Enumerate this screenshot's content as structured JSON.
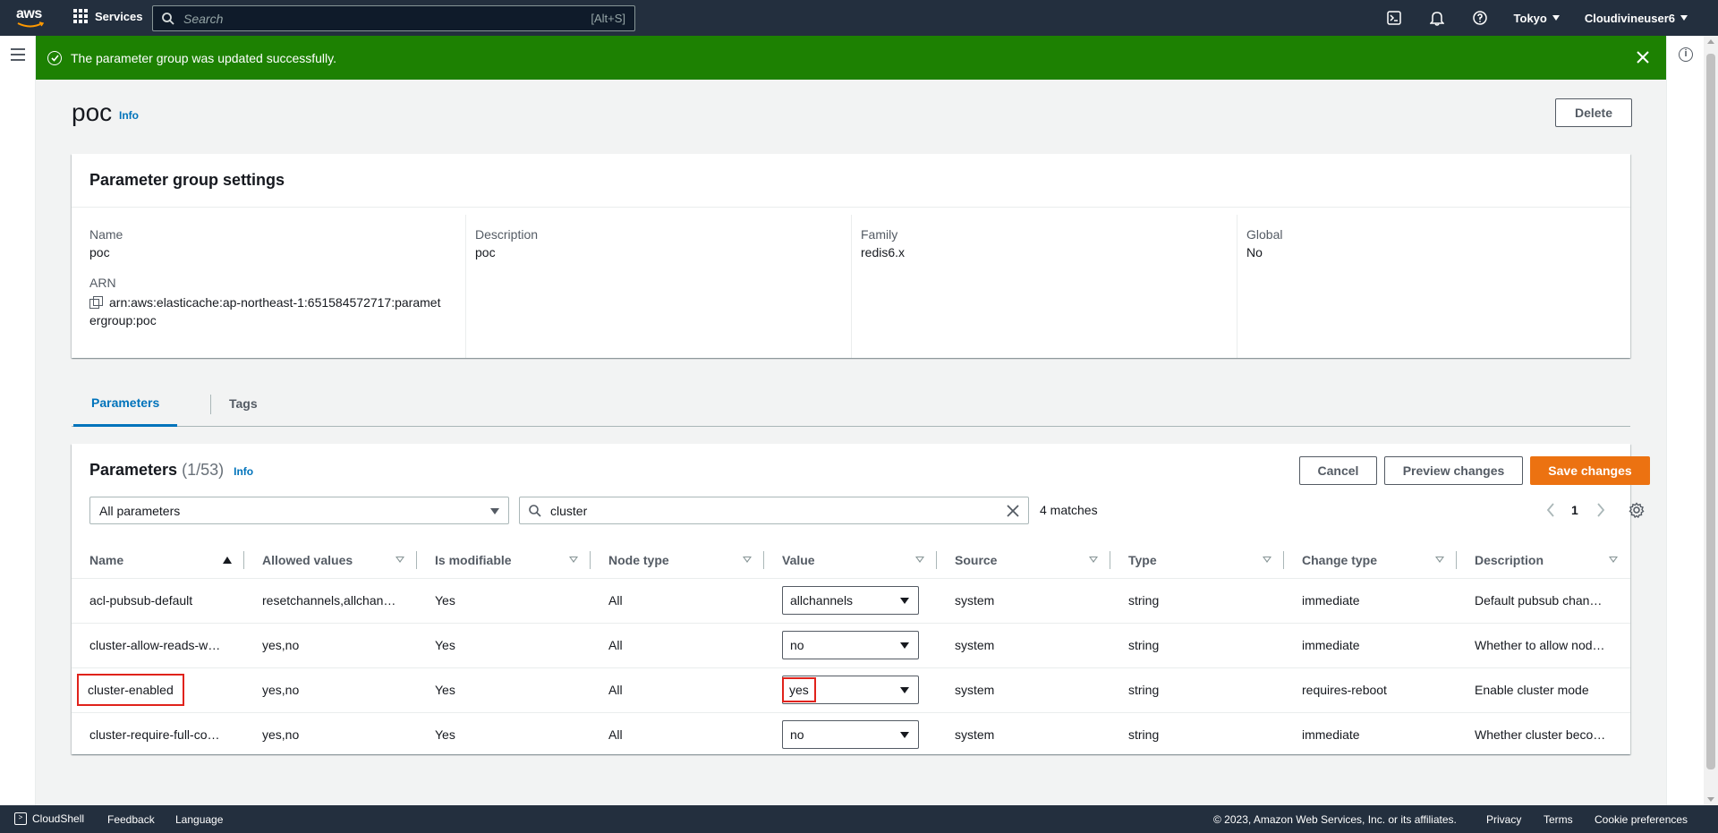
{
  "topnav": {
    "logo": "aws",
    "services_label": "Services",
    "search_placeholder": "Search",
    "search_shortcut": "[Alt+S]",
    "region": "Tokyo",
    "user": "Cloudivineuser6"
  },
  "flash": {
    "message": "The parameter group was updated successfully."
  },
  "page": {
    "title": "poc",
    "info_label": "Info",
    "delete_label": "Delete"
  },
  "settings": {
    "header": "Parameter group settings",
    "name_label": "Name",
    "name_value": "poc",
    "arn_label": "ARN",
    "arn_value_line1": "arn:aws:elasticache:ap-northeast-1:651584572717:paramet",
    "arn_value_line2": "ergroup:poc",
    "description_label": "Description",
    "description_value": "poc",
    "family_label": "Family",
    "family_value": "redis6.x",
    "global_label": "Global",
    "global_value": "No"
  },
  "tabs": [
    {
      "label": "Parameters",
      "active": true
    },
    {
      "label": "Tags",
      "active": false
    }
  ],
  "parameters": {
    "title": "Parameters",
    "count": "(1/53)",
    "info_label": "Info",
    "cancel_label": "Cancel",
    "preview_label": "Preview changes",
    "save_label": "Save changes",
    "filter_select": "All parameters",
    "search_value": "cluster",
    "matches": "4 matches",
    "page_number": "1",
    "columns": [
      "Name",
      "Allowed values",
      "Is modifiable",
      "Node type",
      "Value",
      "Source",
      "Type",
      "Change type",
      "Description"
    ],
    "rows": [
      {
        "name": "acl-pubsub-default",
        "allowed": "resetchannels,allchan…",
        "modifiable": "Yes",
        "node_type": "All",
        "value": "allchannels",
        "source": "system",
        "type": "string",
        "change_type": "immediate",
        "description": "Default pubsub chan…"
      },
      {
        "name": "cluster-allow-reads-w…",
        "allowed": "yes,no",
        "modifiable": "Yes",
        "node_type": "All",
        "value": "no",
        "source": "system",
        "type": "string",
        "change_type": "immediate",
        "description": "Whether to allow nod…"
      },
      {
        "name": "cluster-enabled",
        "allowed": "yes,no",
        "modifiable": "Yes",
        "node_type": "All",
        "value": "yes",
        "source": "system",
        "type": "string",
        "change_type": "requires-reboot",
        "description": "Enable cluster mode"
      },
      {
        "name": "cluster-require-full-co…",
        "allowed": "yes,no",
        "modifiable": "Yes",
        "node_type": "All",
        "value": "no",
        "source": "system",
        "type": "string",
        "change_type": "immediate",
        "description": "Whether cluster beco…"
      }
    ]
  },
  "footer": {
    "cloudshell": "CloudShell",
    "feedback": "Feedback",
    "language": "Language",
    "copyright": "© 2023, Amazon Web Services, Inc. or its affiliates.",
    "privacy": "Privacy",
    "terms": "Terms",
    "cookies": "Cookie preferences"
  },
  "colors": {
    "nav_bg": "#232f3e",
    "success": "#1d8102",
    "primary": "#ec7211",
    "link": "#0073bb",
    "highlight": "#e0221b"
  }
}
